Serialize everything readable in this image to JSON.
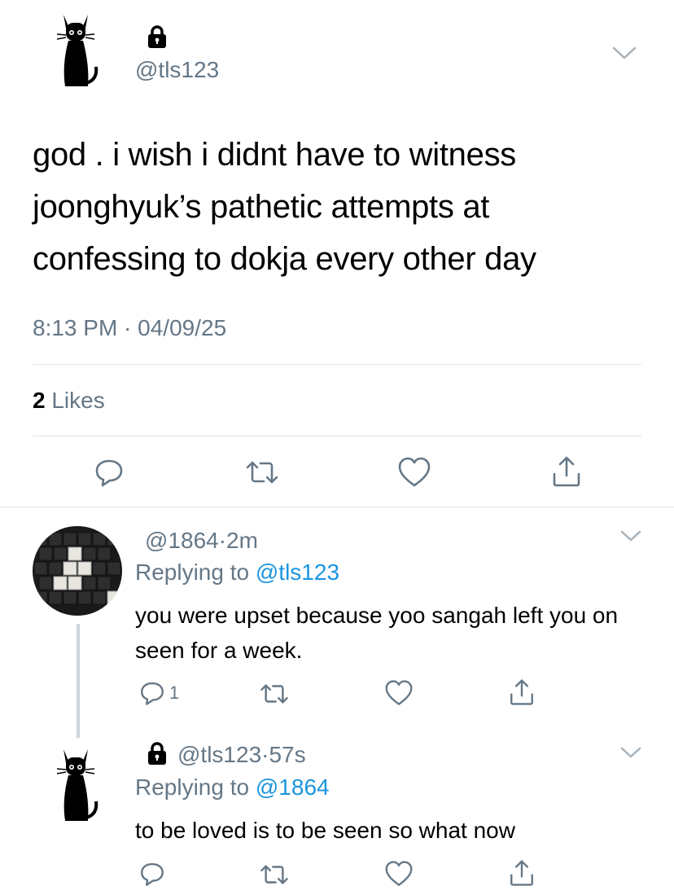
{
  "main_tweet": {
    "handle": "@tls123",
    "text": "god . i wish i didnt have to witness joonghyuk’s pathetic attempts at confessing to dokja every other day",
    "timestamp": "8:13 PM · 04/09/25",
    "likes_count": "2",
    "likes_label": "Likes"
  },
  "reply_1": {
    "handle": "@1864",
    "separator": "·",
    "time": "2m",
    "replying_prefix": "Replying to",
    "replying_to": "@tls123",
    "text": "you were upset because yoo sangah left you on seen for a week.",
    "reply_count": "1"
  },
  "reply_2": {
    "handle": "@tls123",
    "separator": "·",
    "time": "57s",
    "replying_prefix": "Replying to",
    "replying_to": "@1864",
    "text": "to be loved is to be seen so what now"
  },
  "icons": {
    "reply": "reply-icon",
    "retweet": "retweet-icon",
    "like": "heart-icon",
    "share": "share-icon",
    "lock": "lock-icon",
    "chevron": "chevron-down-icon"
  },
  "colors": {
    "secondary_text": "#657786",
    "link": "#1b95e0",
    "divider": "#dfe3e7",
    "icon": "#657786"
  }
}
